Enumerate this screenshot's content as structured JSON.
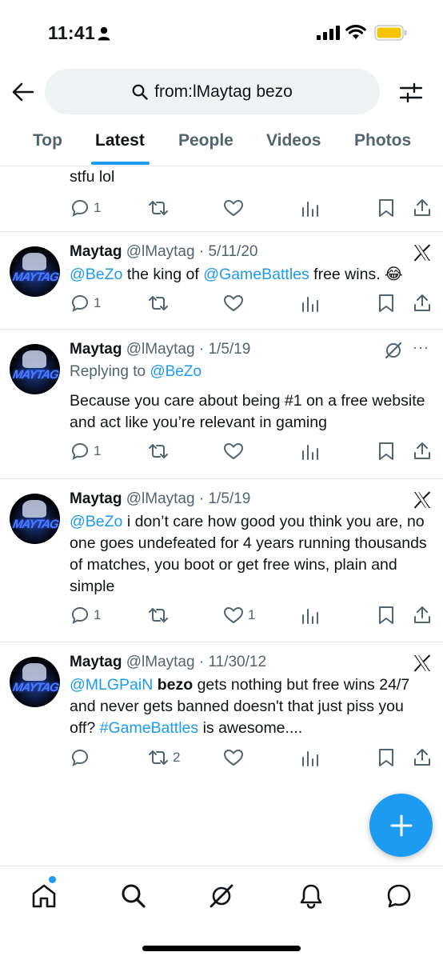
{
  "status_bar": {
    "time": "11:41",
    "icons": [
      "person-icon",
      "signal-icon",
      "wifi-icon",
      "battery-icon"
    ],
    "battery_color": "#f5c400"
  },
  "search": {
    "query": "from:lMaytag bezo"
  },
  "tabs": [
    {
      "label": "Top",
      "active": false
    },
    {
      "label": "Latest",
      "active": true
    },
    {
      "label": "People",
      "active": false
    },
    {
      "label": "Videos",
      "active": false
    },
    {
      "label": "Photos",
      "active": false
    }
  ],
  "colors": {
    "accent": "#1d9bf0",
    "text": "#0f1419",
    "muted": "#536471"
  },
  "tweets": [
    {
      "partial": true,
      "text": "stfu lol",
      "replies": "1",
      "retweets": "",
      "likes": ""
    },
    {
      "name": "Maytag",
      "handle": "@lMaytag",
      "sep": "·",
      "date": "5/11/20",
      "source_icon": "x-logo-icon",
      "mention1": "@BeZo",
      "text_mid": " the king of ",
      "mention2": "@GameBattles",
      "text_end": " free wins. 😂",
      "replies": "1",
      "retweets": "",
      "likes": ""
    },
    {
      "name": "Maytag",
      "handle": "@lMaytag",
      "sep": "·",
      "date": "1/5/19",
      "replying_prefix": "Replying to ",
      "replying_to": "@BeZo",
      "text": "Because you care about being #1 on a free website and act like you’re relevant in gaming",
      "more": "···",
      "replies": "1",
      "retweets": "",
      "likes": ""
    },
    {
      "name": "Maytag",
      "handle": "@lMaytag",
      "sep": "·",
      "date": "1/5/19",
      "mention1": "@BeZo",
      "text_end": " i don’t care how good you think you are, no one goes undefeated for 4 years running thousands of matches, you boot or get free wins, plain and simple",
      "replies": "1",
      "retweets": "",
      "likes": "1"
    },
    {
      "name": "Maytag",
      "handle": "@lMaytag",
      "sep": "·",
      "date": "11/30/12",
      "mention1": "@MLGPaiN",
      "bold_word": " bezo",
      "text_mid": " gets nothing but free wins 24/7 and never gets banned doesn't that just piss you off? ",
      "hashtag": "#GameBattles",
      "text_end": " is awesome....",
      "replies": "",
      "retweets": "2",
      "likes": ""
    }
  ],
  "avatar_text": "MAYTAG",
  "bottom_nav": [
    "home-icon",
    "search-icon",
    "grok-icon",
    "notifications-icon",
    "messages-icon"
  ]
}
